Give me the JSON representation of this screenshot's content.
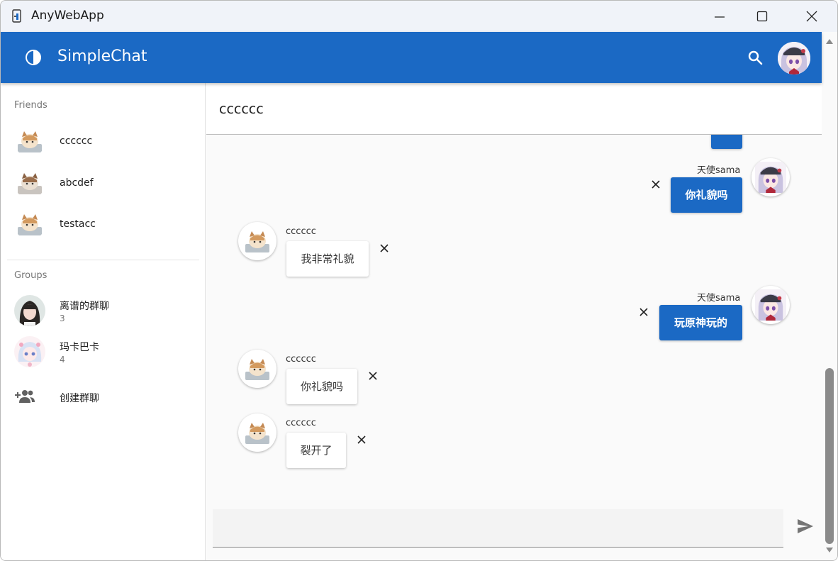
{
  "window": {
    "title": "AnyWebApp"
  },
  "appbar": {
    "title": "SimpleChat"
  },
  "sidebar": {
    "friends_label": "Friends",
    "friends": [
      {
        "name": "cccccc"
      },
      {
        "name": "abcdef"
      },
      {
        "name": "testacc"
      }
    ],
    "groups_label": "Groups",
    "groups": [
      {
        "name": "离谱的群聊",
        "count": "3"
      },
      {
        "name": "玛卡巴卡",
        "count": "4"
      }
    ],
    "create_group_label": "创建群聊"
  },
  "chat": {
    "title": "cccccc",
    "messages": [
      {
        "sender": "天使sama",
        "text": "你礼貌吗",
        "outgoing": true
      },
      {
        "sender": "cccccc",
        "text": "我非常礼貌",
        "outgoing": false
      },
      {
        "sender": "天使sama",
        "text": "玩原神玩的",
        "outgoing": true
      },
      {
        "sender": "cccccc",
        "text": "你礼貌吗",
        "outgoing": false
      },
      {
        "sender": "cccccc",
        "text": "裂开了",
        "outgoing": false
      }
    ],
    "input": {
      "value": "",
      "placeholder": ""
    }
  },
  "colors": {
    "primary": "#1b69c4",
    "chat_bg": "#fafafa",
    "sidebar_bg": "#ffffff"
  },
  "icons": {
    "theme": "contrast-icon",
    "search": "search-icon",
    "send": "send-icon",
    "create_group": "group-add-icon",
    "delete": "close-icon"
  }
}
